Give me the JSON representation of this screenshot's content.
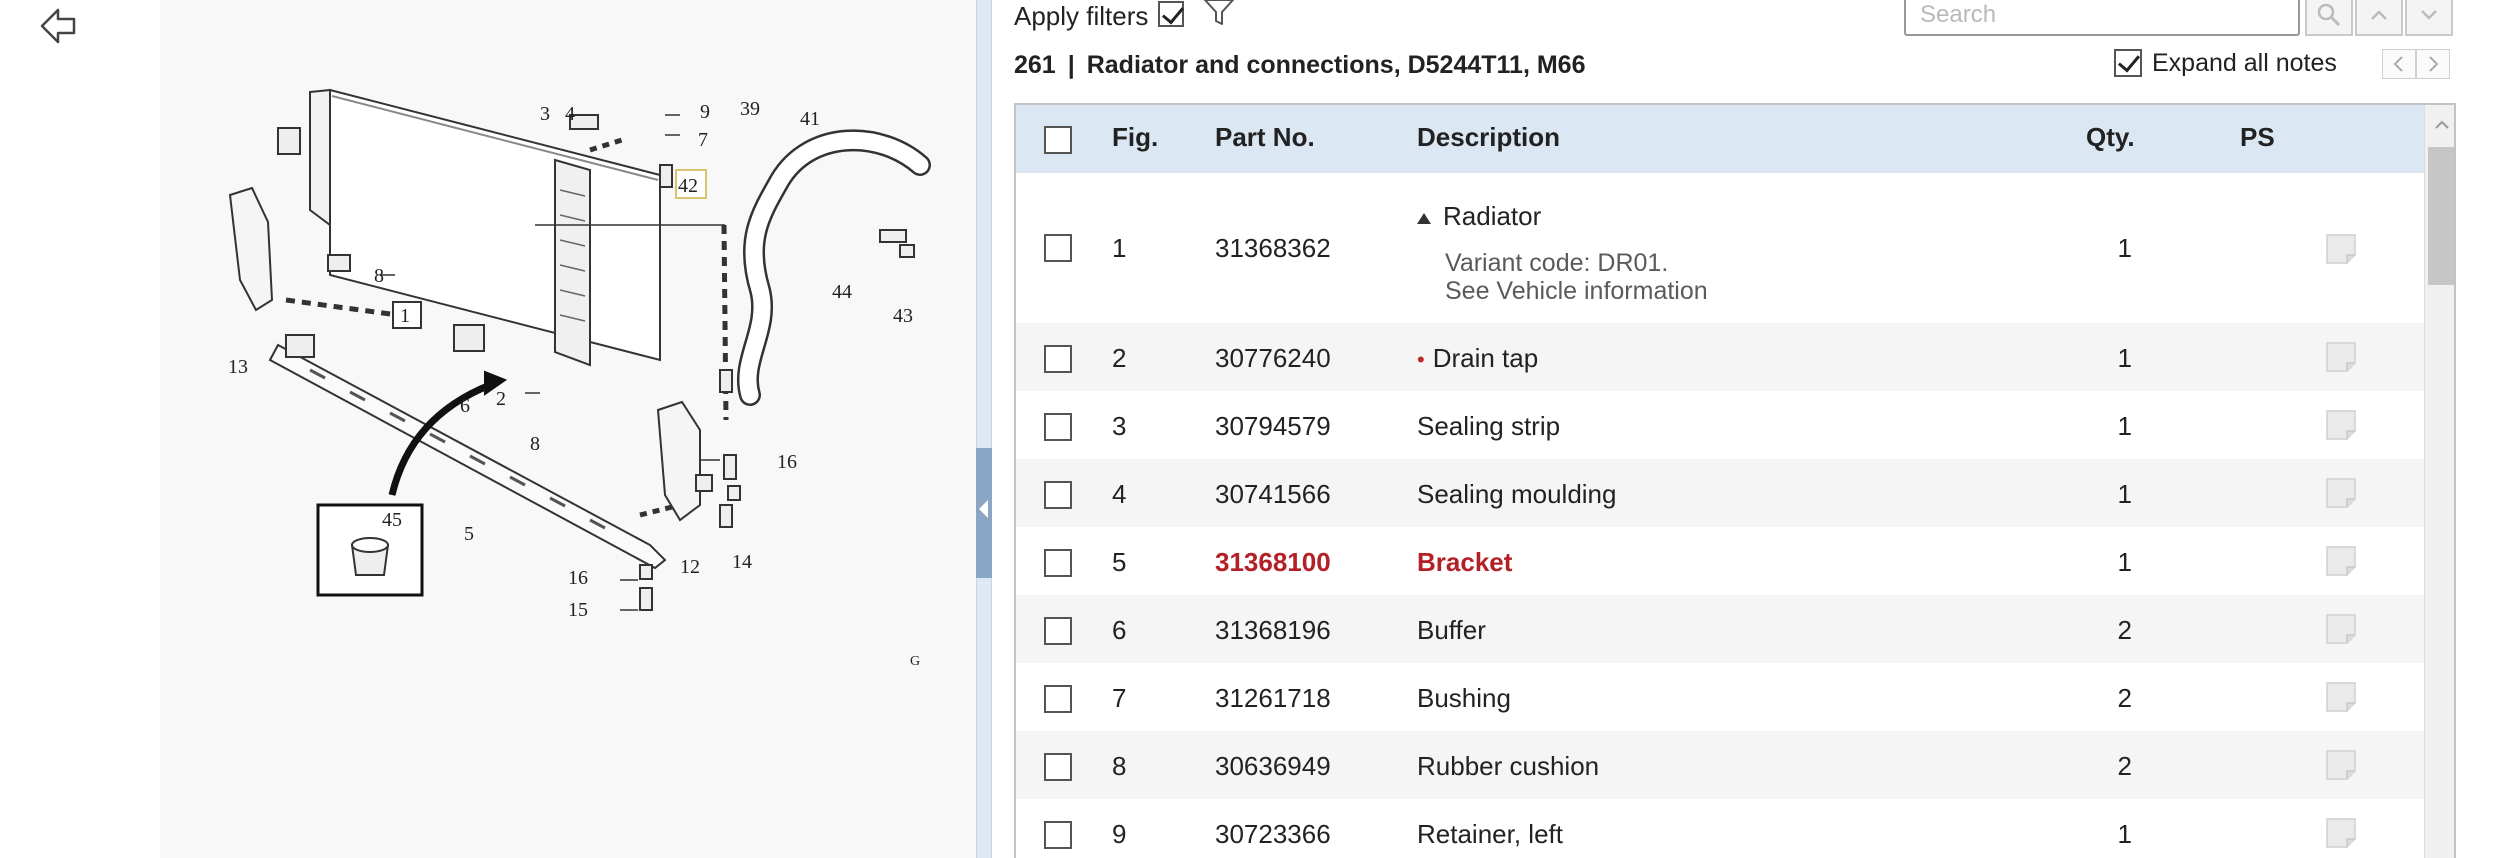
{
  "toolbar": {
    "apply_filters_label": "Apply filters",
    "apply_filters_checked": true,
    "search_placeholder": "Search"
  },
  "section": {
    "number": "261",
    "separator": "|",
    "title": "Radiator and connections, D5244T11, M66"
  },
  "expand_notes": {
    "label": "Expand all notes",
    "checked": true
  },
  "table": {
    "headers": {
      "fig": "Fig.",
      "part_no": "Part No.",
      "description": "Description",
      "qty": "Qty.",
      "ps": "PS"
    },
    "rows": [
      {
        "fig": "1",
        "part_no": "31368362",
        "description": "Radiator",
        "variant_line1": "Variant code: DR01.",
        "variant_line2": "See Vehicle information",
        "qty": "1"
      },
      {
        "fig": "2",
        "part_no": "30776240",
        "description": "Drain tap",
        "qty": "1",
        "marker": "•"
      },
      {
        "fig": "3",
        "part_no": "30794579",
        "description": "Sealing strip",
        "qty": "1"
      },
      {
        "fig": "4",
        "part_no": "30741566",
        "description": "Sealing moulding",
        "qty": "1"
      },
      {
        "fig": "5",
        "part_no": "31368100",
        "description": "Bracket",
        "qty": "1"
      },
      {
        "fig": "6",
        "part_no": "31368196",
        "description": "Buffer",
        "qty": "2"
      },
      {
        "fig": "7",
        "part_no": "31261718",
        "description": "Bushing",
        "qty": "2"
      },
      {
        "fig": "8",
        "part_no": "30636949",
        "description": "Rubber cushion",
        "qty": "2"
      },
      {
        "fig": "9",
        "part_no": "30723366",
        "description": "Retainer, left",
        "qty": "1"
      }
    ]
  },
  "diagram": {
    "labels": [
      "3",
      "4",
      "9",
      "39",
      "41",
      "7",
      "42",
      "8",
      "1",
      "44",
      "43",
      "13",
      "6",
      "2",
      "8",
      "16",
      "45",
      "5",
      "16",
      "12",
      "14",
      "15",
      "G"
    ]
  },
  "colors": {
    "header_bg": "#dbe7f3",
    "highlight_text": "#b32025",
    "splitter": "#8aa6c4"
  }
}
